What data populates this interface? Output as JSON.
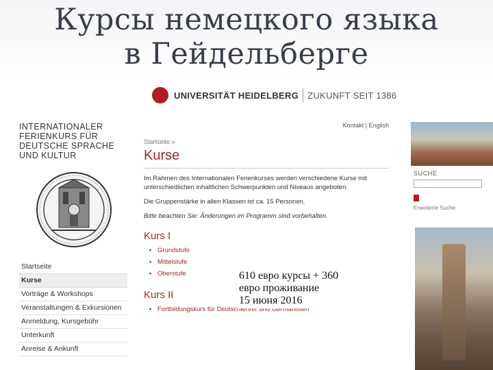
{
  "slide": {
    "title_line1": "Курсы немецкого языка",
    "title_line2": "в Гейдельберге"
  },
  "university": {
    "name": "UNIVERSITÄT HEIDELBERG",
    "tagline": "ZUKUNFT SEIT 1386",
    "brand_color": "#b01e23"
  },
  "institute": {
    "lines": [
      "INTERNATIONALER",
      "FERIENKURS FÜR",
      "DEUTSCHE SPRACHE",
      "UND KULTUR"
    ]
  },
  "nav": {
    "items": [
      {
        "label": "Startseite",
        "active": false
      },
      {
        "label": "Kurse",
        "active": true
      },
      {
        "label": "Vorträge & Workshops",
        "active": false
      },
      {
        "label": "Veranstaltungen & Exkursionen",
        "active": false
      },
      {
        "label": "Anmeldung, Kursgebühr",
        "active": false
      },
      {
        "label": "Unterkunft",
        "active": false
      },
      {
        "label": "Anreise & Ankunft",
        "active": false
      }
    ]
  },
  "top_links": {
    "contact": "Kontakt",
    "separator": "|",
    "english": "English"
  },
  "main": {
    "breadcrumb": "Startseite »",
    "heading": "Kurse",
    "intro": "Im Rahmen des Internationalen Ferienkurses werden verschiedene Kurse mit unterschiedlichen inhaltlichen Schwerpunkten und Niveaus angeboten.",
    "group_size": "Die Gruppenstärke in allen Klassen ist ca. 15 Personen.",
    "notice": "Bitte beachten Sie: Änderungen im Programm sind vorbehalten.",
    "kurs1": {
      "title": "Kurs I",
      "items": [
        "Grundstufe",
        "Mittelstufe",
        "Oberstufe"
      ]
    },
    "kurs2": {
      "title": "Kurs II",
      "items": [
        "Fortbildungskurs für Deutschlehrer und Germanisten"
      ]
    }
  },
  "search": {
    "label": "SUCHE",
    "placeholder": "",
    "advanced": "Erweiterte Suche"
  },
  "overlay": {
    "line1": "610 евро курсы + 360",
    "line2": "евро проживание",
    "line3": "15 июня 2016"
  }
}
